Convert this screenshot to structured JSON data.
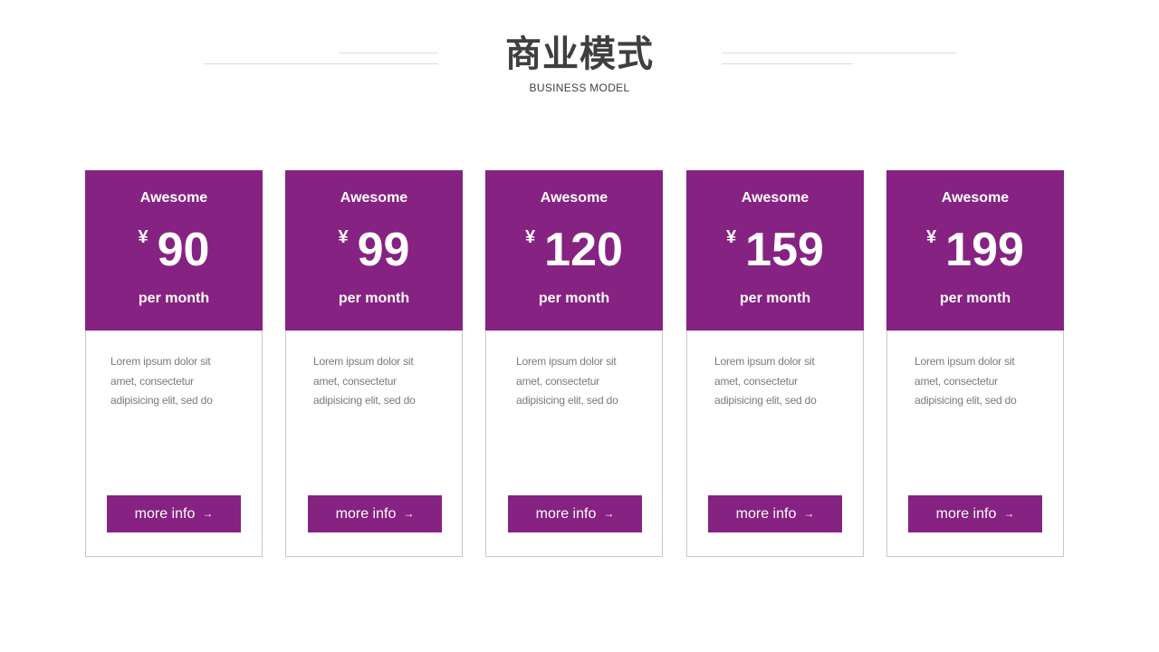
{
  "header": {
    "title": "商业模式",
    "subtitle": "BUSINESS MODEL"
  },
  "colors": {
    "accent": "#862281",
    "border": "#c8c8c8",
    "title": "#3f3f3f",
    "body_text": "#7a7a7a"
  },
  "plans": [
    {
      "name": "Awesome",
      "currency": "¥",
      "price": "90",
      "period": "per month",
      "desc_lines": [
        "Lorem ipsum dolor sit",
        "amet, consectetur",
        "adipisicing elit, sed do"
      ],
      "button_label": "more info",
      "button_icon": "→"
    },
    {
      "name": "Awesome",
      "currency": "¥",
      "price": "99",
      "period": "per month",
      "desc_lines": [
        "Lorem ipsum dolor sit",
        "amet, consectetur",
        "adipisicing elit, sed do"
      ],
      "button_label": "more info",
      "button_icon": "→"
    },
    {
      "name": "Awesome",
      "currency": "¥",
      "price": "120",
      "period": "per month",
      "desc_lines": [
        "Lorem ipsum dolor sit",
        "amet, consectetur",
        "adipisicing elit, sed do"
      ],
      "button_label": "more info",
      "button_icon": "→"
    },
    {
      "name": "Awesome",
      "currency": "¥",
      "price": "159",
      "period": "per month",
      "desc_lines": [
        "Lorem ipsum dolor sit",
        "amet, consectetur",
        "adipisicing elit, sed do"
      ],
      "button_label": "more info",
      "button_icon": "→"
    },
    {
      "name": "Awesome",
      "currency": "¥",
      "price": "199",
      "period": "per month",
      "desc_lines": [
        "Lorem ipsum dolor sit",
        "amet, consectetur",
        "adipisicing elit, sed do"
      ],
      "button_label": "more info",
      "button_icon": "→"
    }
  ]
}
